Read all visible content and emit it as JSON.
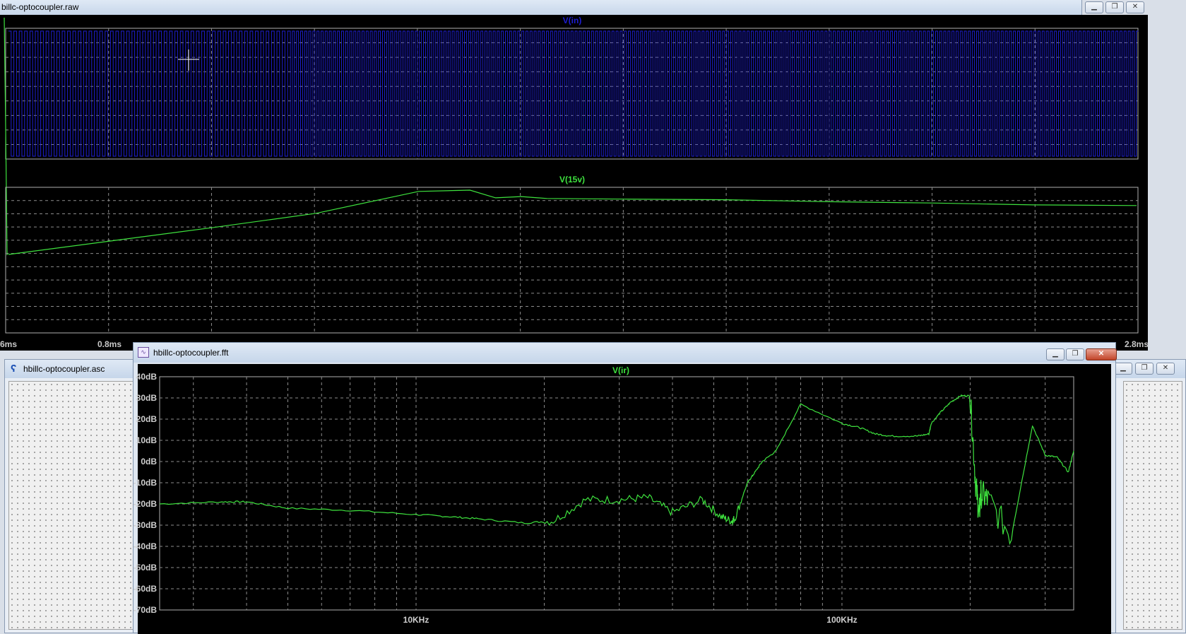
{
  "raw_window": {
    "title": "billc-optocoupler.raw",
    "pane1": {
      "trace": "V(in)"
    },
    "pane2": {
      "trace": "V(15v)"
    },
    "x_ticks": [
      "6ms",
      "0.8ms",
      "2.8ms"
    ]
  },
  "asc_window": {
    "title": "hbillc-optocoupler.asc"
  },
  "fft_window": {
    "title": "hbillc-optocoupler.fft",
    "trace": "V(ir)",
    "y_ticks": [
      "40dB",
      "30dB",
      "20dB",
      "10dB",
      "0dB",
      "-10dB",
      "-20dB",
      "-30dB",
      "-40dB",
      "-50dB",
      "-60dB",
      "-70dB"
    ],
    "x_ticks": [
      "10KHz",
      "100KHz"
    ]
  },
  "colors": {
    "blue_trace": "#1e1ed2",
    "green_trace": "#3ee23e",
    "grid": "#8c8c8c"
  },
  "icons": {
    "minimize": "minimize-icon",
    "restore": "restore-icon",
    "close": "close-icon"
  },
  "chart_data": [
    {
      "type": "line",
      "title": "V(in)",
      "x": [
        0.6,
        2.8
      ],
      "series": [
        {
          "name": "V(in)",
          "shape": "square-wave",
          "values": [
            0,
            1
          ]
        }
      ],
      "grid": true
    },
    {
      "type": "line",
      "title": "V(15v)",
      "xlim": [
        0.6,
        2.8
      ],
      "series": [
        {
          "name": "V(15v)",
          "x": [
            0.6,
            0.8,
            1.0,
            1.2,
            1.4,
            1.5,
            1.55,
            1.6,
            1.65,
            1.8,
            2.0,
            2.2,
            2.4,
            2.6,
            2.8
          ],
          "values": [
            0.0,
            0.21,
            0.42,
            0.64,
            0.98,
            1.0,
            0.88,
            0.9,
            0.87,
            0.86,
            0.85,
            0.82,
            0.8,
            0.77,
            0.76
          ]
        }
      ],
      "grid": true
    },
    {
      "type": "line",
      "title": "V(ir)",
      "xlabel": "",
      "ylabel": "",
      "log_x": true,
      "xlim": [
        2500,
        350000
      ],
      "ylim": [
        -70,
        40
      ],
      "series": [
        {
          "name": "V(ir)",
          "x": [
            2500,
            3500,
            4000,
            5000,
            7000,
            10000,
            12000,
            14000,
            18000,
            21000,
            25000,
            30000,
            35000,
            40000,
            47000,
            52000,
            55000,
            56000,
            60000,
            62000,
            65000,
            70000,
            80000,
            100000,
            110000,
            120000,
            130000,
            150000,
            160000,
            162000,
            170000,
            180000,
            190000,
            200000,
            206000,
            210000,
            212000,
            220000,
            250000,
            280000,
            300000,
            320000,
            340000,
            350000
          ],
          "values": [
            -20,
            -19,
            -19,
            -22,
            -23,
            -25,
            -26,
            -27,
            -29,
            -28,
            -18,
            -18,
            -17,
            -24,
            -18,
            -26,
            -28,
            -27,
            -10,
            -6,
            0,
            5,
            27,
            18,
            16,
            13,
            12,
            12,
            13,
            18,
            23,
            28,
            31,
            31,
            -10,
            -25,
            -15,
            -18,
            -35,
            17,
            3,
            2,
            -5,
            5
          ]
        }
      ],
      "grid": true
    }
  ]
}
